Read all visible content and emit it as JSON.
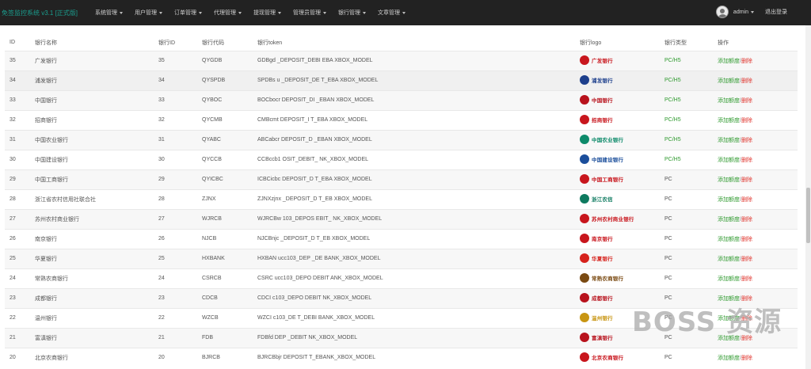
{
  "app": {
    "brand": "免签监控系统 v3.1 [正式版]"
  },
  "nav": {
    "items": [
      {
        "label": "系统管理"
      },
      {
        "label": "用户管理"
      },
      {
        "label": "订单管理"
      },
      {
        "label": "代理管理"
      },
      {
        "label": "提现管理"
      },
      {
        "label": "管理员管理"
      },
      {
        "label": "银行管理"
      },
      {
        "label": "文章管理"
      }
    ],
    "user": "admin",
    "logout": "退出登录"
  },
  "table": {
    "headers": {
      "id": "ID",
      "name": "银行名称",
      "bank_id": "银行ID",
      "code": "银行代码",
      "token": "银行token",
      "logo": "银行logo",
      "type": "银行类型",
      "ops": "操作"
    },
    "action_add": "添加额度",
    "action_sep": "/",
    "action_delete": "删除",
    "rows": [
      {
        "id": "35",
        "name": "广发银行",
        "bank_id": "35",
        "code": "QYGDB",
        "token": "GDBgd          _DEPOSIT_DEBI      EBA      XBOX_MODEL",
        "logo_text": "广发银行",
        "logo_color": "#c8161d",
        "type": "PC/H5"
      },
      {
        "id": "34",
        "name": "浦发银行",
        "bank_id": "34",
        "code": "QYSPDB",
        "token": "SPDBs      u      _DEPOSIT_DE       T_EBA      XBOX_MODEL",
        "logo_text": "浦发银行",
        "logo_color": "#1d3f8c",
        "type": "PC/H5"
      },
      {
        "id": "33",
        "name": "中国银行",
        "bank_id": "33",
        "code": "QYBOC",
        "token": "BOCbocr          DEPOSIT_DI        _EBAN      XBOX_MODEL",
        "logo_text": "中国银行",
        "logo_color": "#b8121c",
        "type": "PC/H5"
      },
      {
        "id": "32",
        "name": "招商银行",
        "bank_id": "32",
        "code": "QYCMB",
        "token": "CMBcmt          DEPOSIT_I        T_EBA      XBOX_MODEL",
        "logo_text": "招商银行",
        "logo_color": "#c8161d",
        "type": "PC/H5"
      },
      {
        "id": "31",
        "name": "中国农业银行",
        "bank_id": "31",
        "code": "QYABC",
        "token": "ABCabcr          DEPOSIT_D        _EBAN      XBOX_MODEL",
        "logo_text": "中国农业银行",
        "logo_color": "#0d8a6a",
        "type": "PC/H5"
      },
      {
        "id": "30",
        "name": "中国建设银行",
        "bank_id": "30",
        "code": "QYCCB",
        "token": "CCBccb1          OSIT_DEBIT_      NK_XBOX_MODEL",
        "logo_text": "中国建设银行",
        "logo_color": "#1b4e9b",
        "type": "PC/H5"
      },
      {
        "id": "29",
        "name": "中国工商银行",
        "bank_id": "29",
        "code": "QYICBC",
        "token": "ICBCicbc          DEPOSIT_D       T_EBA      XBOX_MODEL",
        "logo_text": "中国工商银行",
        "logo_color": "#c8161d",
        "type": "PC"
      },
      {
        "id": "28",
        "name": "浙江省农村信用社联合社",
        "bank_id": "28",
        "code": "ZJNX",
        "token": "ZJNXzjnx          _DEPOSIT_D       T_EB      XBOX_MODEL",
        "logo_text": "浙江农信",
        "logo_color": "#0d7a5f",
        "type": "PC"
      },
      {
        "id": "27",
        "name": "苏州农村商业银行",
        "bank_id": "27",
        "code": "WJRCB",
        "token": "WJRCBw          103_DEPOS      EBIT_      NK_XBOX_MODEL",
        "logo_text": "苏州农村商业银行",
        "logo_color": "#c8161d",
        "type": "PC"
      },
      {
        "id": "26",
        "name": "南京银行",
        "bank_id": "26",
        "code": "NJCB",
        "token": "NJCBnjc          _DEPOSIT_D       T_EB      XBOX_MODEL",
        "logo_text": "南京银行",
        "logo_color": "#c8161d",
        "type": "PC"
      },
      {
        "id": "25",
        "name": "华夏银行",
        "bank_id": "25",
        "code": "HXBANK",
        "token": "HXBAN          ucc103_DEP        _DE        BANK_XBOX_MODEL",
        "logo_text": "华夏银行",
        "logo_color": "#d6221c",
        "type": "PC"
      },
      {
        "id": "24",
        "name": "常熟农商银行",
        "bank_id": "24",
        "code": "CSRCB",
        "token": "CSRC          ucc103_DEPO        DEBIT        ANK_XBOX_MODEL",
        "logo_text": "常熟农商银行",
        "logo_color": "#7a4a12",
        "type": "PC"
      },
      {
        "id": "23",
        "name": "成都银行",
        "bank_id": "23",
        "code": "CDCB",
        "token": "CDCI          c103_DEPO        DEBIT        NK_XBOX_MODEL",
        "logo_text": "成都银行",
        "logo_color": "#b8121c",
        "type": "PC"
      },
      {
        "id": "22",
        "name": "温州银行",
        "bank_id": "22",
        "code": "WZCB",
        "token": "WZCI          c103_DE        T_DEBI        BANK_XBOX_MODEL",
        "logo_text": "温州银行",
        "logo_color": "#c89512",
        "type": "PC"
      },
      {
        "id": "21",
        "name": "富滇银行",
        "bank_id": "21",
        "code": "FDB",
        "token": "FDBfd          DEP        _DEBIT        NK_XBOX_MODEL",
        "logo_text": "富滇银行",
        "logo_color": "#b8121c",
        "type": "PC"
      },
      {
        "id": "20",
        "name": "北京农商银行",
        "bank_id": "20",
        "code": "BJRCB",
        "token": "BJRCBbjr          DEPOSIT        T_EBANK_XBOX_MODEL",
        "logo_text": "北京农商银行",
        "logo_color": "#c8161d",
        "type": "PC"
      }
    ]
  },
  "watermark": "BOSS 资源"
}
